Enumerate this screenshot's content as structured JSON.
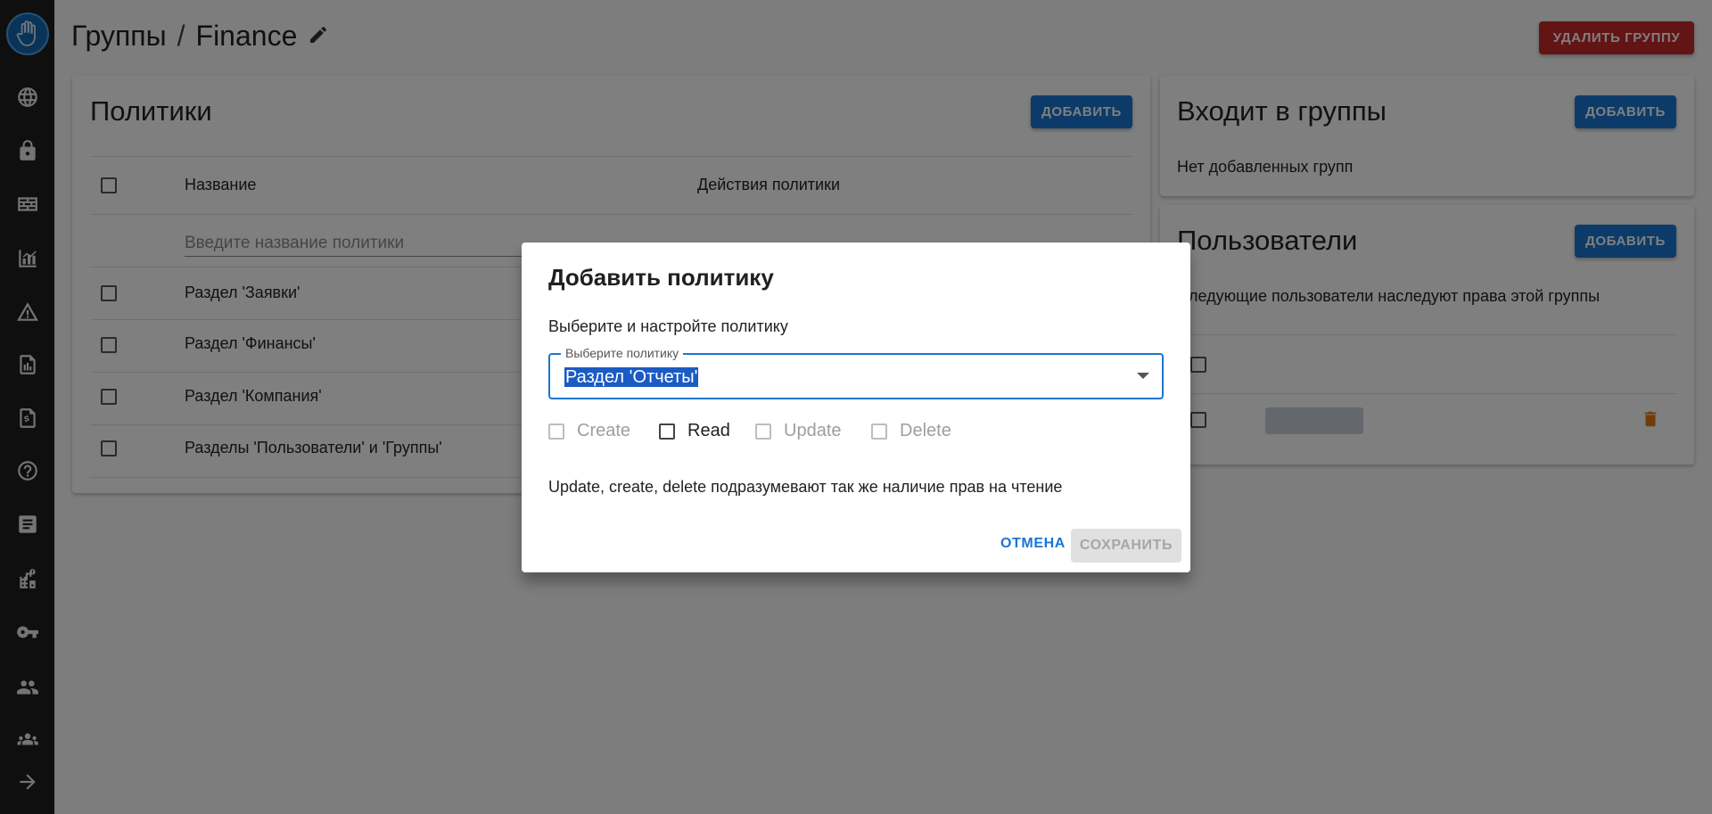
{
  "header": {
    "breadcrumb_root": "Группы",
    "separator": "/",
    "group_name": "Finance",
    "delete_button": "Удалить группу"
  },
  "sidebar": {
    "items": [
      {
        "icon": "globe-icon"
      },
      {
        "icon": "lock-icon"
      },
      {
        "icon": "wall-icon"
      },
      {
        "icon": "chart-icon"
      },
      {
        "icon": "warning-icon"
      },
      {
        "icon": "report-icon"
      },
      {
        "icon": "finance-doc-icon"
      },
      {
        "icon": "help-icon"
      },
      {
        "icon": "article-icon"
      },
      {
        "icon": "building-info-icon"
      },
      {
        "icon": "key-icon"
      },
      {
        "icon": "people-icon"
      },
      {
        "icon": "groups-icon"
      },
      {
        "icon": "arrow-right-icon"
      }
    ]
  },
  "policies": {
    "title": "Политики",
    "add_button": "Добавить",
    "columns": [
      "Название",
      "Действия политики"
    ],
    "filter_placeholder": "Введите название политики",
    "rows": [
      "Раздел 'Заявки'",
      "Раздел 'Финансы'",
      "Раздел 'Компания'",
      "Разделы 'Пользователи' и 'Группы'"
    ]
  },
  "member_of": {
    "title": "Входит в группы",
    "add_button": "Добавить",
    "empty_text": "Нет добавленных групп"
  },
  "users": {
    "title": "Пользователи",
    "add_button": "Добавить",
    "description": "Следующие пользователи наследуют права этой группы"
  },
  "dialog": {
    "title": "Добавить политику",
    "subtitle": "Выберите и настройте политику",
    "select_label": "Выберите политику",
    "select_value": "Раздел 'Отчеты'",
    "permissions": [
      {
        "label": "Create",
        "checked": false,
        "enabled": false
      },
      {
        "label": "Read",
        "checked": false,
        "enabled": true
      },
      {
        "label": "Update",
        "checked": false,
        "enabled": false
      },
      {
        "label": "Delete",
        "checked": false,
        "enabled": false
      }
    ],
    "note": "Update, create, delete подразумевают так же наличие прав на чтение",
    "cancel_button": "Отмена",
    "save_button": "Сохранить"
  },
  "colors": {
    "primary": "#1976d2",
    "danger": "#c62828",
    "sidebar": "#1f1f1f",
    "trash": "#e07a10"
  }
}
